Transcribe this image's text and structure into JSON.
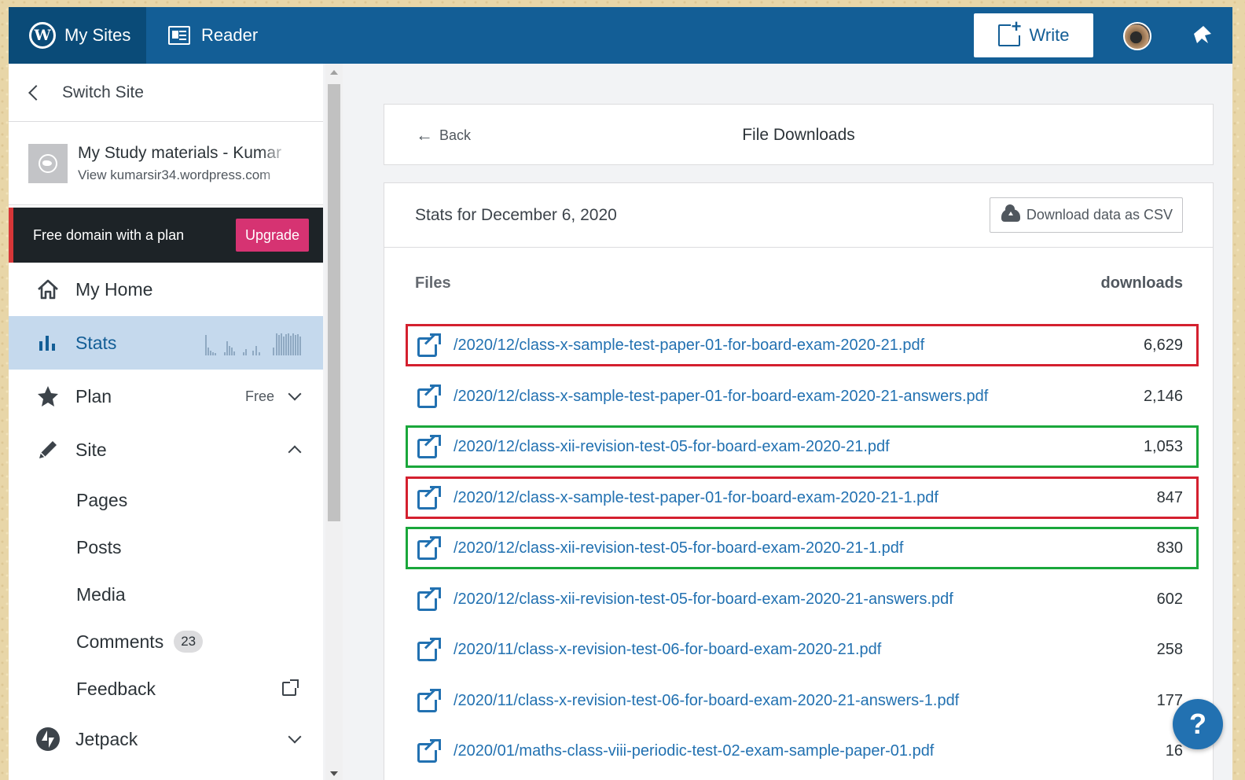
{
  "masterbar": {
    "my_sites": "My Sites",
    "reader": "Reader",
    "write": "Write"
  },
  "sidebar": {
    "switch_site": "Switch Site",
    "site_name": "My Study materials - Kumar",
    "site_url": "View kumarsir34.wordpress.com",
    "promo_text": "Free domain with a plan",
    "upgrade": "Upgrade",
    "items": [
      {
        "label": "My Home",
        "icon": "home-icon"
      },
      {
        "label": "Stats",
        "icon": "stats-icon",
        "active": true
      },
      {
        "label": "Plan",
        "icon": "star-icon",
        "badge": "Free"
      },
      {
        "label": "Site",
        "icon": "pencil-icon"
      }
    ],
    "sub_items": [
      {
        "label": "Pages"
      },
      {
        "label": "Posts"
      },
      {
        "label": "Media"
      },
      {
        "label": "Comments",
        "count": "23"
      },
      {
        "label": "Feedback"
      }
    ],
    "jetpack": "Jetpack"
  },
  "main": {
    "back": "Back",
    "title": "File Downloads",
    "stats_date": "Stats for December 6, 2020",
    "csv_button": "Download data as CSV",
    "col_files": "Files",
    "col_downloads": "downloads",
    "rows": [
      {
        "path": "/2020/12/class-x-sample-test-paper-01-for-board-exam-2020-21.pdf",
        "count": "6,629",
        "highlight": "red"
      },
      {
        "path": "/2020/12/class-x-sample-test-paper-01-for-board-exam-2020-21-answers.pdf",
        "count": "2,146",
        "highlight": ""
      },
      {
        "path": "/2020/12/class-xii-revision-test-05-for-board-exam-2020-21.pdf",
        "count": "1,053",
        "highlight": "green"
      },
      {
        "path": "/2020/12/class-x-sample-test-paper-01-for-board-exam-2020-21-1.pdf",
        "count": "847",
        "highlight": "red"
      },
      {
        "path": "/2020/12/class-xii-revision-test-05-for-board-exam-2020-21-1.pdf",
        "count": "830",
        "highlight": "green"
      },
      {
        "path": "/2020/12/class-xii-revision-test-05-for-board-exam-2020-21-answers.pdf",
        "count": "602",
        "highlight": ""
      },
      {
        "path": "/2020/11/class-x-revision-test-06-for-board-exam-2020-21.pdf",
        "count": "258",
        "highlight": ""
      },
      {
        "path": "/2020/11/class-x-revision-test-06-for-board-exam-2020-21-answers-1.pdf",
        "count": "177",
        "highlight": ""
      },
      {
        "path": "/2020/01/maths-class-viii-periodic-test-02-exam-sample-paper-01.pdf",
        "count": "16",
        "highlight": ""
      }
    ]
  },
  "help": "?",
  "colors": {
    "masterbar": "#135e96",
    "link": "#2271b1",
    "highlight_red": "#d4202f",
    "highlight_green": "#1aa73b",
    "upgrade": "#d63372"
  }
}
